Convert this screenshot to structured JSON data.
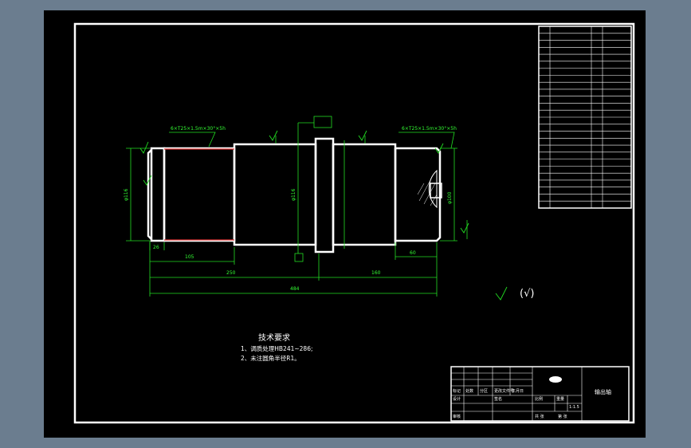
{
  "colors": {
    "background": "#6b7d8f",
    "sheet": "#000000",
    "outline": "#ffffff",
    "dimension": "#22dd22",
    "highlight": "#dd3333"
  },
  "dimensions": {
    "d1": "105",
    "d2": "250",
    "d3": "160",
    "d4": "484",
    "d5": "60",
    "d6": "26",
    "dia_left": "φ116",
    "dia_mid": "φ116",
    "dia_right": "φ100"
  },
  "annotations": {
    "roughness_sym": "√",
    "roughness_note": "(√)",
    "spline_left": "6×T25×1.5m×30°×5h",
    "spline_right": "6×T25×1.5m×30°×5h"
  },
  "notes": {
    "heading": "技术要求",
    "items": [
      "1、调质处理HB241~286;",
      "2、未注圆角半径R1。"
    ]
  },
  "title_block": {
    "part_name": "输出轴",
    "scale": "1:1.5",
    "labels": [
      "比例",
      "重量",
      "共 张",
      "第 张",
      "设计",
      "审核",
      "标记",
      "处数",
      "分区",
      "更改文件号",
      "签名",
      "年月日"
    ]
  },
  "param_table": {
    "rows": 26
  }
}
